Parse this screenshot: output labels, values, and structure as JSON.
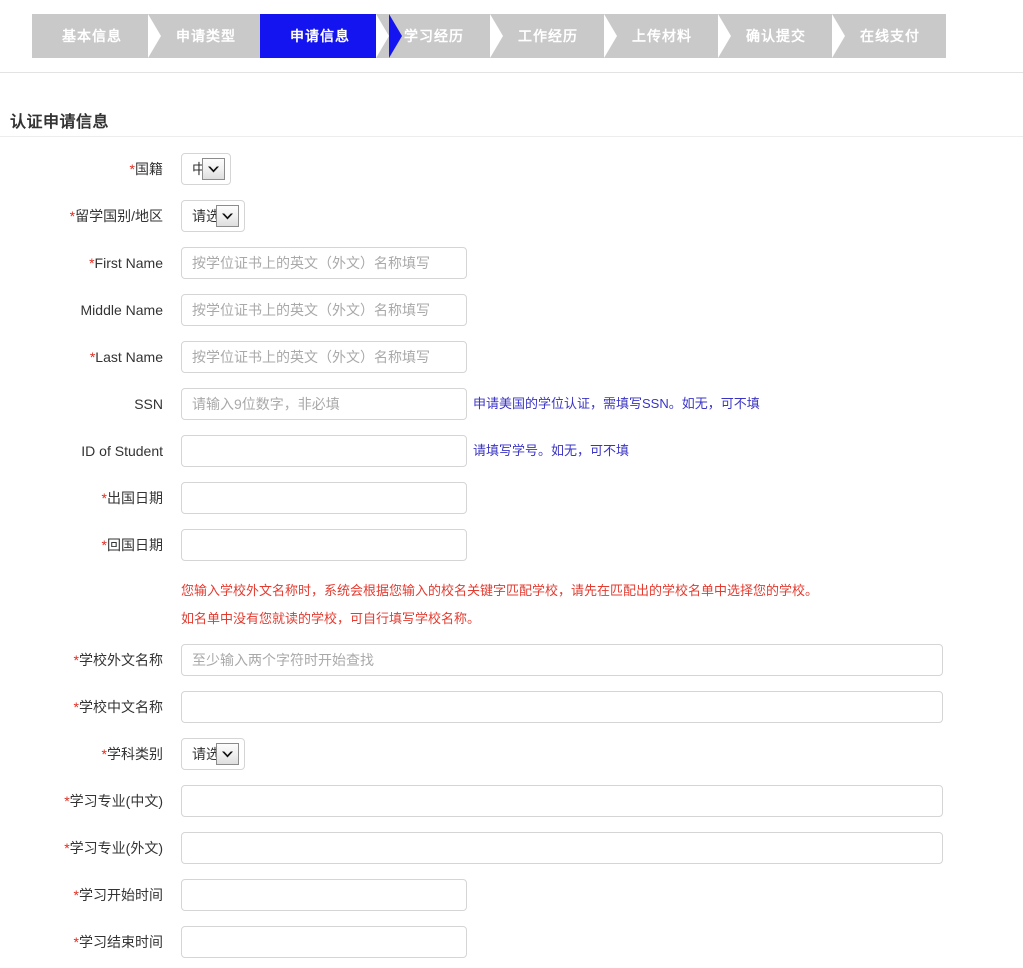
{
  "steps": [
    {
      "label": "基本信息",
      "state": "done"
    },
    {
      "label": "申请类型",
      "state": "done"
    },
    {
      "label": "申请信息",
      "state": "active"
    },
    {
      "label": "学习经历",
      "state": "todo"
    },
    {
      "label": "工作经历",
      "state": "todo"
    },
    {
      "label": "上传材料",
      "state": "todo"
    },
    {
      "label": "确认提交",
      "state": "todo"
    },
    {
      "label": "在线支付",
      "state": "todo"
    }
  ],
  "colors": {
    "active_step": "#1414f0",
    "inactive_step": "#c9c9c9",
    "required_mark": "#e02b20",
    "hint_text": "#3a34c4",
    "notice_text": "#e33b30"
  },
  "page": {
    "section_title": "认证申请信息"
  },
  "notices": [
    "您输入学校外文名称时，系统会根据您输入的校名关键字匹配学校，请先在匹配出的学校名单中选择您的学校。",
    "如名单中没有您就读的学校，可自行填写学校名称。"
  ],
  "fields": {
    "nationality": {
      "label": "国籍",
      "required": true,
      "type": "select",
      "value": "中国"
    },
    "study_country": {
      "label": "留学国别/地区",
      "required": true,
      "type": "select",
      "value": "请选择"
    },
    "first_name": {
      "label": "First Name",
      "required": true,
      "type": "text",
      "value": "",
      "placeholder": "按学位证书上的英文（外文）名称填写"
    },
    "middle_name": {
      "label": "Middle Name",
      "required": false,
      "type": "text",
      "value": "",
      "placeholder": "按学位证书上的英文（外文）名称填写"
    },
    "last_name": {
      "label": "Last Name",
      "required": true,
      "type": "text",
      "value": "",
      "placeholder": "按学位证书上的英文（外文）名称填写"
    },
    "ssn": {
      "label": "SSN",
      "required": false,
      "type": "text",
      "value": "",
      "placeholder": "请输入9位数字，非必填",
      "hint": "申请美国的学位认证，需填写SSN。如无，可不填"
    },
    "id_of_student": {
      "label": "ID of Student",
      "required": false,
      "type": "text",
      "value": "",
      "placeholder": "",
      "hint": "请填写学号。如无，可不填"
    },
    "depart_date": {
      "label": "出国日期",
      "required": true,
      "type": "text",
      "value": "",
      "placeholder": ""
    },
    "return_date": {
      "label": "回国日期",
      "required": true,
      "type": "text",
      "value": "",
      "placeholder": ""
    },
    "school_foreign_name": {
      "label": "学校外文名称",
      "required": true,
      "type": "text",
      "value": "",
      "placeholder": "至少输入两个字符时开始查找"
    },
    "school_chinese_name": {
      "label": "学校中文名称",
      "required": true,
      "type": "text",
      "value": "",
      "placeholder": ""
    },
    "subject_category": {
      "label": "学科类别",
      "required": true,
      "type": "select",
      "value": "请选择"
    },
    "major_chinese": {
      "label": "学习专业(中文)",
      "required": true,
      "type": "text",
      "value": "",
      "placeholder": ""
    },
    "major_foreign": {
      "label": "学习专业(外文)",
      "required": true,
      "type": "text",
      "value": "",
      "placeholder": ""
    },
    "study_start": {
      "label": "学习开始时间",
      "required": true,
      "type": "text",
      "value": "",
      "placeholder": ""
    },
    "study_end": {
      "label": "学习结束时间",
      "required": true,
      "type": "text",
      "value": "",
      "placeholder": ""
    }
  },
  "icons": {
    "dropdown": "chevron-down-icon"
  }
}
